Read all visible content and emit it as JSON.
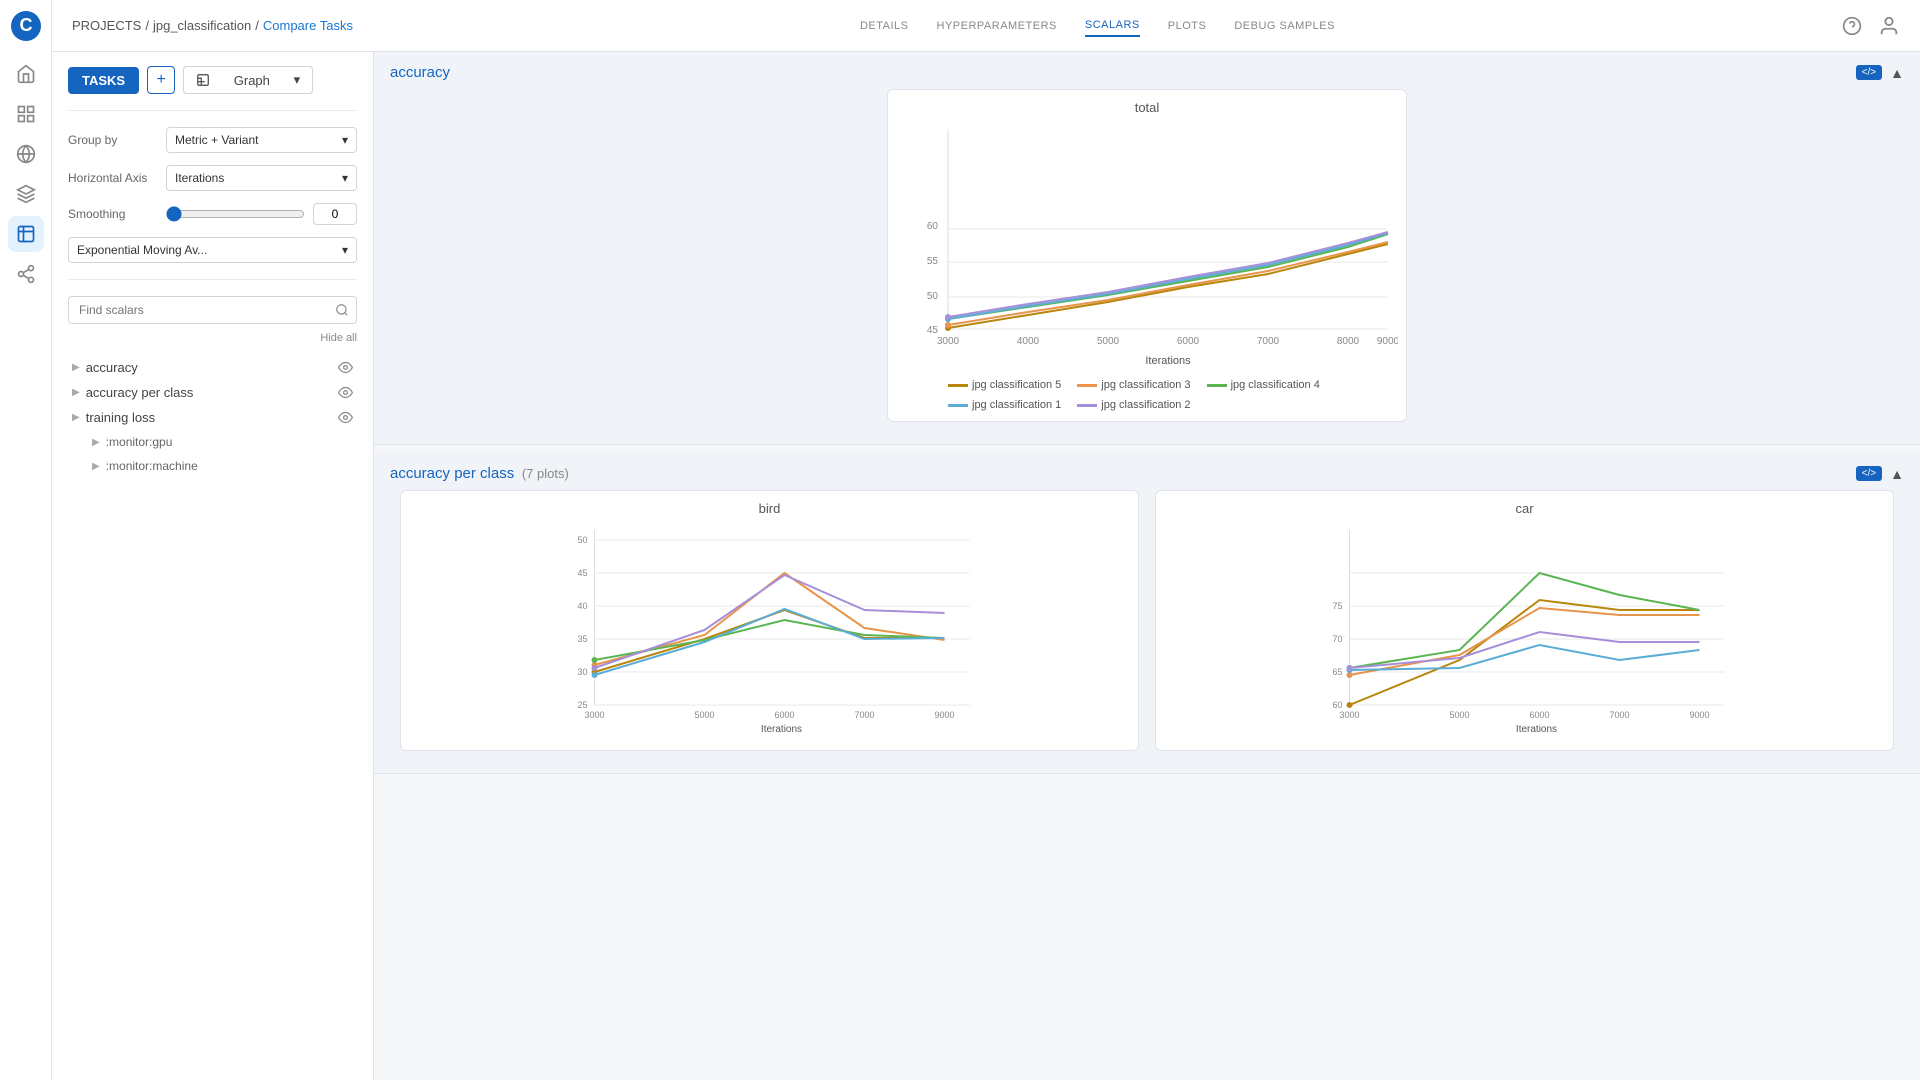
{
  "app": {
    "logo": "C",
    "breadcrumb": [
      "PROJECTS",
      "jpg_classification",
      "Compare Tasks"
    ],
    "nav_tabs": [
      {
        "label": "DETAILS",
        "active": false
      },
      {
        "label": "HYPERPARAMETERS",
        "active": false
      },
      {
        "label": "SCALARS",
        "active": true
      },
      {
        "label": "PLOTS",
        "active": false
      },
      {
        "label": "DEBUG SAMPLES",
        "active": false
      }
    ]
  },
  "toolbar": {
    "tasks_label": "TASKS",
    "graph_label": "Graph"
  },
  "sidebar": {
    "group_by_label": "Group by",
    "group_by_value": "Metric + Variant",
    "horizontal_axis_label": "Horizontal Axis",
    "horizontal_axis_value": "Iterations",
    "smoothing_label": "Smoothing",
    "smoothing_value": "0",
    "smoothing_method": "Exponential Moving Av...",
    "find_scalars_placeholder": "Find scalars",
    "hide_all": "Hide all",
    "scalar_items": [
      {
        "name": "accuracy",
        "visible": true,
        "expanded": false
      },
      {
        "name": "accuracy per class",
        "visible": true,
        "expanded": false
      },
      {
        "name": "training loss",
        "visible": true,
        "expanded": false
      },
      {
        "name": ":monitor:gpu",
        "visible": false,
        "expanded": false,
        "sub": true
      },
      {
        "name": ":monitor:machine",
        "visible": false,
        "expanded": false,
        "sub": true
      }
    ]
  },
  "charts": {
    "accuracy": {
      "title": "accuracy",
      "sub_title": "total",
      "x_label": "Iterations",
      "y_min": 45,
      "y_max": 60,
      "x_min": 3000,
      "x_max": 9000,
      "legend": [
        {
          "label": "jpg classification 5",
          "color": "#b8860b"
        },
        {
          "label": "jpg classification 3",
          "color": "#e8944a"
        },
        {
          "label": "jpg classification 4",
          "color": "#5ab552"
        },
        {
          "label": "jpg classification 1",
          "color": "#5bacd6"
        },
        {
          "label": "jpg classification 2",
          "color": "#a68fd8"
        }
      ]
    },
    "accuracy_per_class": {
      "title": "accuracy per class",
      "plots_count": "7 plots",
      "sub_charts": [
        {
          "title": "bird"
        },
        {
          "title": "car"
        }
      ]
    }
  }
}
